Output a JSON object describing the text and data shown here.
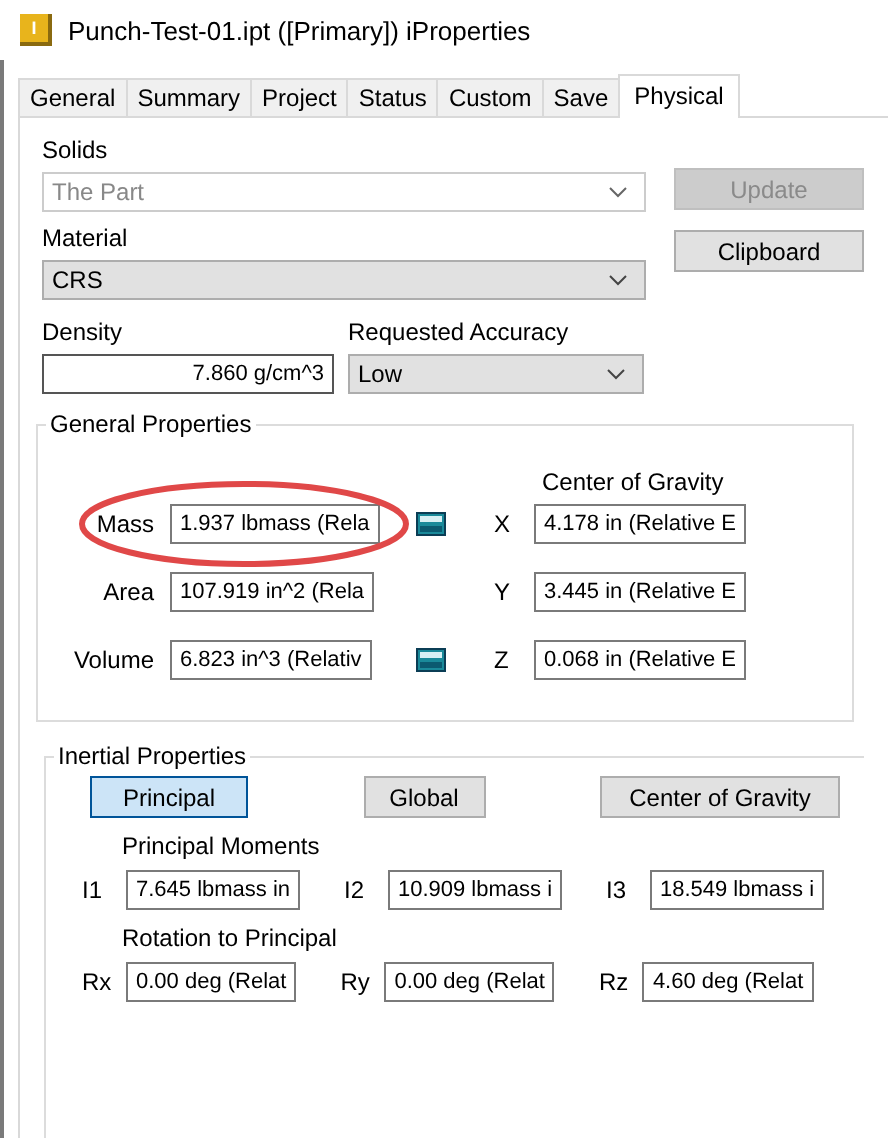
{
  "window": {
    "title": "Punch-Test-01.ipt ([Primary]) iProperties",
    "icon_letter": "I"
  },
  "tabs": [
    {
      "label": "General",
      "selected": false
    },
    {
      "label": "Summary",
      "selected": false
    },
    {
      "label": "Project",
      "selected": false
    },
    {
      "label": "Status",
      "selected": false
    },
    {
      "label": "Custom",
      "selected": false
    },
    {
      "label": "Save",
      "selected": false
    },
    {
      "label": "Physical",
      "selected": true
    }
  ],
  "solids": {
    "label": "Solids",
    "value": "The Part",
    "disabled": true
  },
  "buttons": [
    {
      "label": "Update",
      "disabled": true
    },
    {
      "label": "Clipboard",
      "disabled": false
    }
  ],
  "material": {
    "label": "Material",
    "value": "CRS"
  },
  "density": {
    "label": "Density",
    "value": "7.860 g/cm^3"
  },
  "accuracy": {
    "label": "Requested Accuracy",
    "value": "Low"
  },
  "general_properties": {
    "title": "General Properties",
    "cog_title": "Center of Gravity",
    "properties": [
      {
        "label": "Mass",
        "value": "1.937 lbmass (Rela",
        "calculator": true,
        "highlighted": true
      },
      {
        "label": "Area",
        "value": "107.919 in^2 (Rela",
        "calculator": false,
        "highlighted": false
      },
      {
        "label": "Volume",
        "value": "6.823 in^3 (Relativ",
        "calculator": true,
        "highlighted": false
      }
    ],
    "center_of_gravity": [
      {
        "label": "X",
        "value": "4.178 in (Relative E"
      },
      {
        "label": "Y",
        "value": "3.445 in (Relative E"
      },
      {
        "label": "Z",
        "value": "0.068 in (Relative E"
      }
    ]
  },
  "inertial_properties": {
    "title": "Inertial Properties",
    "modes": [
      {
        "label": "Principal",
        "selected": true
      },
      {
        "label": "Global",
        "selected": false
      },
      {
        "label": "Center of Gravity",
        "selected": false
      }
    ],
    "moments_title": "Principal Moments",
    "moments": [
      {
        "label": "I1",
        "value": "7.645 lbmass in"
      },
      {
        "label": "I2",
        "value": "10.909 lbmass i"
      },
      {
        "label": "I3",
        "value": "18.549 lbmass i"
      }
    ],
    "rotation_title": "Rotation to Principal",
    "rotations": [
      {
        "label": "Rx",
        "value": "0.00 deg (Relat"
      },
      {
        "label": "Ry",
        "value": "0.00 deg (Relat"
      },
      {
        "label": "Rz",
        "value": "4.60 deg (Relat"
      }
    ]
  }
}
